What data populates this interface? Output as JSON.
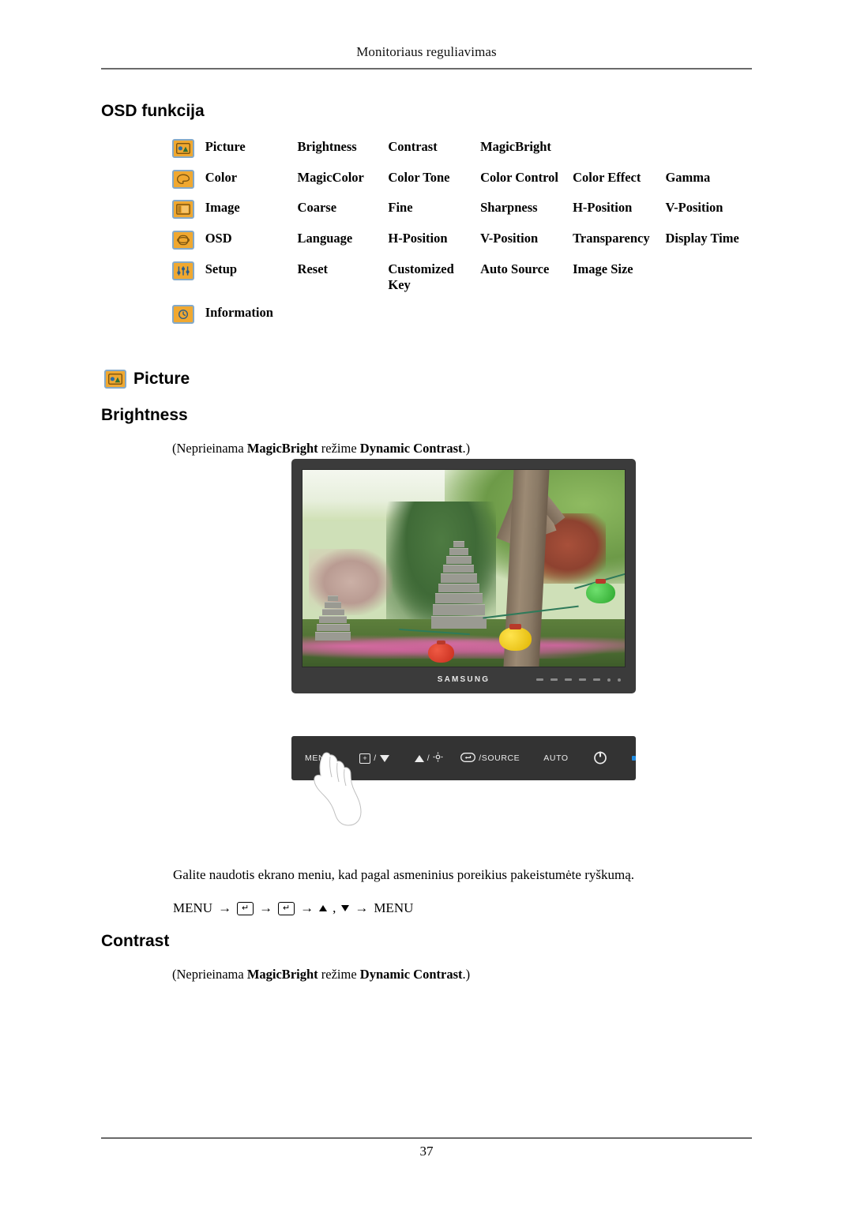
{
  "header": {
    "running_title": "Monitoriaus reguliavimas"
  },
  "headings": {
    "osd_function": "OSD funkcija",
    "picture": "Picture",
    "brightness": "Brightness",
    "contrast": "Contrast"
  },
  "osd_table": {
    "rows": [
      {
        "icon": "picture-icon",
        "name": "Picture",
        "items": [
          "Brightness",
          "Contrast",
          "MagicBright",
          "",
          ""
        ]
      },
      {
        "icon": "color-palette-icon",
        "name": "Color",
        "items": [
          "MagicColor",
          "Color Tone",
          "Color Control",
          "Color Effect",
          "Gamma"
        ]
      },
      {
        "icon": "image-icon",
        "name": "Image",
        "items": [
          "Coarse",
          "Fine",
          "Sharpness",
          "H-Position",
          "V-Position"
        ]
      },
      {
        "icon": "osd-icon",
        "name": "OSD",
        "items": [
          "Language",
          "H-Position",
          "V-Position",
          "Transparency",
          "Display Time"
        ]
      },
      {
        "icon": "setup-sliders-icon",
        "name": "Setup",
        "items": [
          "Reset",
          "Customized Key",
          "Auto Source",
          "Image Size",
          ""
        ]
      },
      {
        "icon": "information-clock-icon",
        "name": "Information",
        "items": [
          "",
          "",
          "",
          "",
          ""
        ]
      }
    ]
  },
  "notes": {
    "brightness_prefix": "(Neprieinama ",
    "brightness_bold1": "MagicBright",
    "brightness_middle": " režime ",
    "brightness_bold2": "Dynamic Contrast",
    "brightness_suffix": ".)",
    "contrast_prefix": "(Neprieinama ",
    "contrast_bold1": "MagicBright",
    "contrast_middle": " režime ",
    "contrast_bold2": "Dynamic Contrast",
    "contrast_suffix": ".)"
  },
  "monitor": {
    "brand": "SAMSUNG"
  },
  "controls": {
    "menu_label": "MENU",
    "down_label": "/",
    "up_label": "/",
    "source_label": "/SOURCE",
    "auto_label": "AUTO",
    "power_label": "",
    "led_label": ""
  },
  "body": {
    "brightness_description": "Galite naudotis ekrano meniu, kad pagal asmeninius poreikius pakeistumėte ryškumą.",
    "menu_path_start": "MENU",
    "menu_path_arrow": "→",
    "menu_path_enter": "↵",
    "menu_path_comma": ",",
    "menu_path_end": "MENU"
  },
  "footer": {
    "page_number": "37"
  },
  "colors": {
    "icon_fill": "#f0a830",
    "icon_border": "#84a9c8",
    "bezel": "#3b3b3b",
    "control_bar": "#333333",
    "led": "#1f8ae0",
    "rule": "#6a6a6a"
  }
}
